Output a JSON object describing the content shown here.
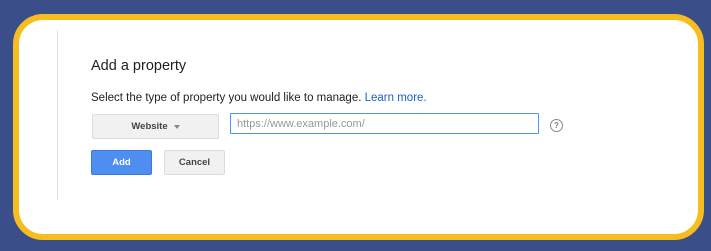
{
  "dialog": {
    "title": "Add a property",
    "instruction": "Select the type of property you would like to manage.",
    "learn_more": "Learn more."
  },
  "form": {
    "type_select": {
      "value": "Website"
    },
    "url_input": {
      "placeholder": "https://www.example.com/",
      "value": ""
    },
    "help_icon": "?"
  },
  "buttons": {
    "add": "Add",
    "cancel": "Cancel"
  },
  "colors": {
    "background": "#3a4e8a",
    "frame_border": "#f5bd1e",
    "primary_button": "#4d8ef0",
    "link": "#1a5fc7"
  },
  "icons": [
    "chevron-down-icon",
    "help-icon"
  ]
}
